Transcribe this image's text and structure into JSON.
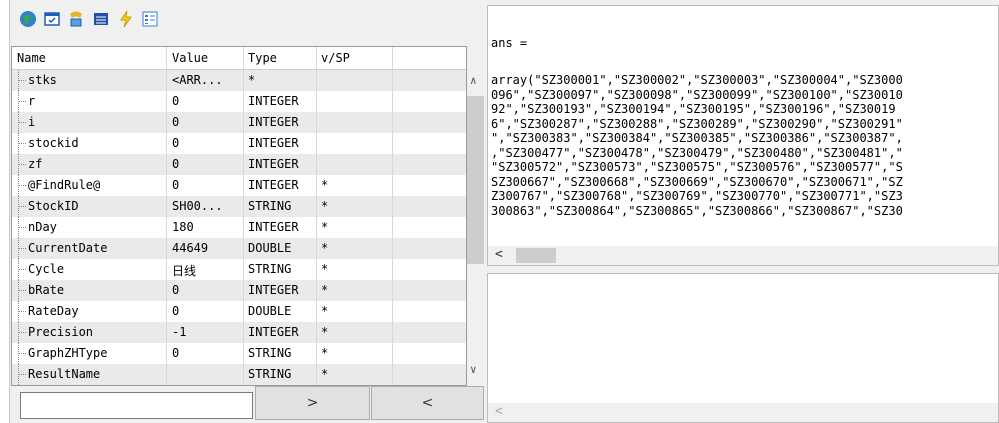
{
  "toolbar": {
    "icons": [
      "globe-icon",
      "dialog-icon",
      "tools-icon",
      "list-icon",
      "lightning-icon",
      "grid-icon"
    ]
  },
  "table": {
    "headers": {
      "name": "Name",
      "value": "Value",
      "type": "Type",
      "vsp": "v/SP"
    },
    "rows": [
      {
        "name": "stks",
        "value": "<ARR...",
        "type": "*",
        "vsp": ""
      },
      {
        "name": "r",
        "value": "0",
        "type": "INTEGER",
        "vsp": ""
      },
      {
        "name": "i",
        "value": "0",
        "type": "INTEGER",
        "vsp": ""
      },
      {
        "name": "stockid",
        "value": "0",
        "type": "INTEGER",
        "vsp": ""
      },
      {
        "name": "zf",
        "value": "0",
        "type": "INTEGER",
        "vsp": ""
      },
      {
        "name": "@FindRule@",
        "value": "0",
        "type": "INTEGER",
        "vsp": "*"
      },
      {
        "name": "StockID",
        "value": "SH00...",
        "type": "STRING",
        "vsp": "*"
      },
      {
        "name": "nDay",
        "value": "180",
        "type": "INTEGER",
        "vsp": "*"
      },
      {
        "name": "CurrentDate",
        "value": "44649",
        "type": "DOUBLE",
        "vsp": "*"
      },
      {
        "name": "Cycle",
        "value": "日线",
        "type": "STRING",
        "vsp": "*"
      },
      {
        "name": "bRate",
        "value": "0",
        "type": "INTEGER",
        "vsp": "*"
      },
      {
        "name": "RateDay",
        "value": "0",
        "type": "DOUBLE",
        "vsp": "*"
      },
      {
        "name": "Precision",
        "value": "-1",
        "type": "INTEGER",
        "vsp": "*"
      },
      {
        "name": "GraphZHType",
        "value": "0",
        "type": "STRING",
        "vsp": "*"
      },
      {
        "name": "ResultName",
        "value": "",
        "type": "STRING",
        "vsp": "*"
      }
    ]
  },
  "controls": {
    "input_value": "",
    "next_label": ">",
    "prev_label": "<"
  },
  "output": {
    "ans_label": "ans =",
    "lines": [
      "array(\"SZ300001\",\"SZ300002\",\"SZ300003\",\"SZ300004\",\"SZ3000",
      "096\",\"SZ300097\",\"SZ300098\",\"SZ300099\",\"SZ300100\",\"SZ30010",
      "92\",\"SZ300193\",\"SZ300194\",\"SZ300195\",\"SZ300196\",\"SZ30019",
      "6\",\"SZ300287\",\"SZ300288\",\"SZ300289\",\"SZ300290\",\"SZ300291\"",
      "\",\"SZ300383\",\"SZ300384\",\"SZ300385\",\"SZ300386\",\"SZ300387\",",
      ",\"SZ300477\",\"SZ300478\",\"SZ300479\",\"SZ300480\",\"SZ300481\",\"",
      "\"SZ300572\",\"SZ300573\",\"SZ300575\",\"SZ300576\",\"SZ300577\",\"S",
      "SZ300667\",\"SZ300668\",\"SZ300669\",\"SZ300670\",\"SZ300671\",\"SZ",
      "Z300767\",\"SZ300768\",\"SZ300769\",\"SZ300770\",\"SZ300771\",\"SZ3",
      "300863\",\"SZ300864\",\"SZ300865\",\"SZ300866\",\"SZ300867\",\"SZ30"
    ],
    "scroll_left": "<"
  }
}
